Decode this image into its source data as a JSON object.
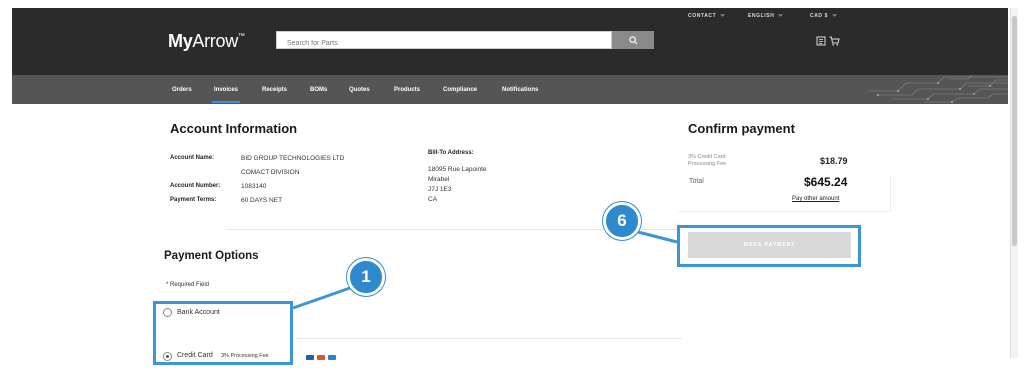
{
  "header": {
    "logo_bold": "My",
    "logo_light": "Arrow",
    "logo_tm": "™",
    "search_placeholder": "Search for Parts",
    "contact": "CONTACT",
    "language": "ENGLISH",
    "currency": "CAD $"
  },
  "nav": {
    "items": [
      {
        "label": "Orders"
      },
      {
        "label": "Invoices"
      },
      {
        "label": "Receipts"
      },
      {
        "label": "BOMs"
      },
      {
        "label": "Quotes"
      },
      {
        "label": "Products"
      },
      {
        "label": "Compliance"
      },
      {
        "label": "Notifications"
      }
    ]
  },
  "account": {
    "title": "Account Information",
    "name_label": "Account Name:",
    "name_line1": "BID GROUP TECHNOLOGIES LTD",
    "name_line2": "COMACT DIVISION",
    "number_label": "Account Number:",
    "number": "1083140",
    "terms_label": "Payment Terms:",
    "terms": "60 DAYS NET",
    "bill_to_label": "Bill-To Address:",
    "address": [
      "18095 Rue Lapointe",
      "Mirabel",
      "J7J 1E3",
      "CA"
    ]
  },
  "payment_options": {
    "title": "Payment Options",
    "required": "* Required Field",
    "bank": "Bank Account",
    "credit": "Credit Card",
    "credit_fee": "3% Processing Fee"
  },
  "confirm": {
    "title": "Confirm payment",
    "fee_label_1": "3% Credit Card",
    "fee_label_2": "Processing Fee",
    "fee_amount": "$18.79",
    "total_label": "Total",
    "total_amount": "$645.24",
    "pay_other": "Pay other amount",
    "make_payment": "MAKE PAYMENT"
  },
  "callouts": {
    "one": "1",
    "six": "6"
  },
  "colors": {
    "header_bg": "#2b2b2b",
    "nav_bg": "#555555",
    "highlight": "#3c95d6",
    "callout": "#2e89cd"
  }
}
